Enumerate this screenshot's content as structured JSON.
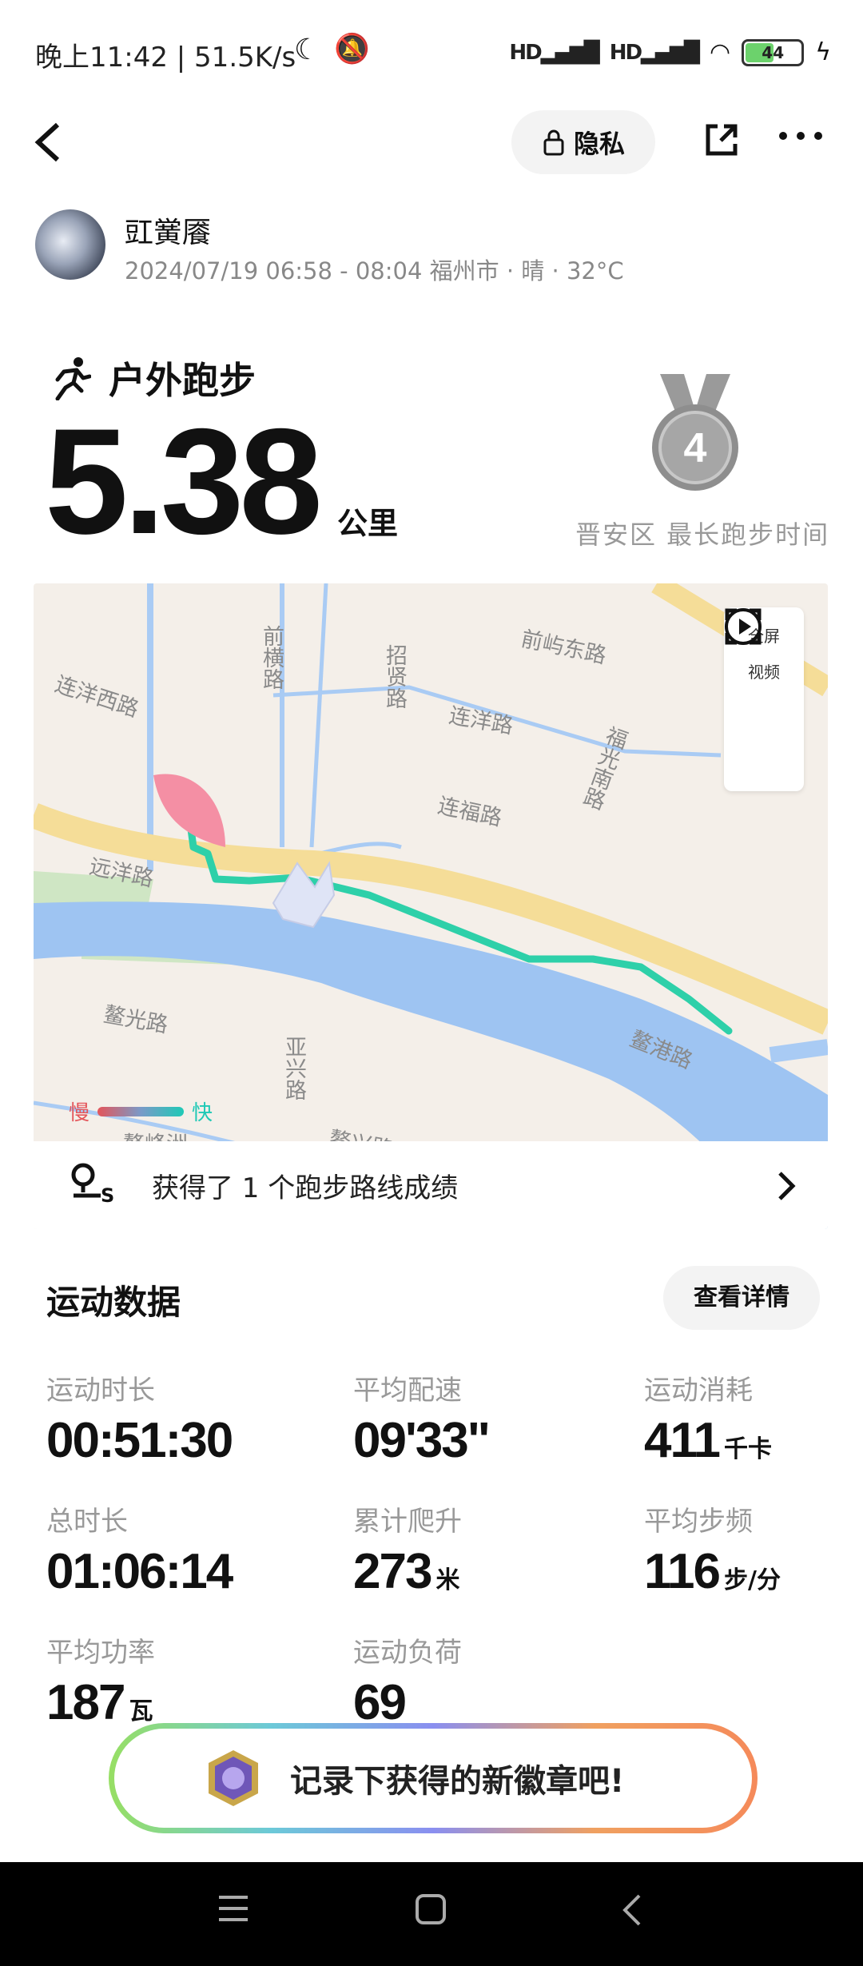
{
  "status_bar": {
    "time_speed": "晚上11:42 | 51.5K/s",
    "signal1": "HD",
    "signal2": "HD",
    "battery": "44"
  },
  "header": {
    "privacy_label": "隐私"
  },
  "user": {
    "name": "豇黉餍",
    "meta": "2024/07/19 06:58 - 08:04 福州市 · 晴 · 32°C"
  },
  "activity": {
    "type": "户外跑步",
    "distance": "5.38",
    "distance_unit": "公里",
    "medal_number": "4",
    "medal_caption": "晋安区 最长跑步时间"
  },
  "map": {
    "roads": [
      "连洋西路",
      "前横路",
      "招贤路",
      "前屿东路",
      "连洋路",
      "福光南路",
      "连福路",
      "远洋路",
      "鳌光路",
      "亚兴路",
      "鳌港路",
      "鳌峰洲",
      "鳌兴路"
    ],
    "fullscreen_label": "全屏",
    "video_label": "视频",
    "legend_slow": "慢",
    "legend_fast": "快",
    "route_banner": "获得了 1 个跑步路线成绩"
  },
  "stats": {
    "title": "运动数据",
    "details_button": "查看详情",
    "items": [
      {
        "label": "运动时长",
        "value": "00:51:30",
        "unit": ""
      },
      {
        "label": "平均配速",
        "value": "09'33\"",
        "unit": ""
      },
      {
        "label": "运动消耗",
        "value": "411",
        "unit": "千卡"
      },
      {
        "label": "总时长",
        "value": "01:06:14",
        "unit": ""
      },
      {
        "label": "累计爬升",
        "value": "273",
        "unit": "米"
      },
      {
        "label": "平均步频",
        "value": "116",
        "unit": "步/分"
      },
      {
        "label": "平均功率",
        "value": "187",
        "unit": "瓦"
      },
      {
        "label": "运动负荷",
        "value": "69",
        "unit": ""
      }
    ]
  },
  "badge_banner": {
    "text": "记录下获得的新徽章吧!"
  },
  "colors": {
    "route": "#1fc9a6",
    "water": "#9ec4f2",
    "main_road": "#f7df9a"
  }
}
